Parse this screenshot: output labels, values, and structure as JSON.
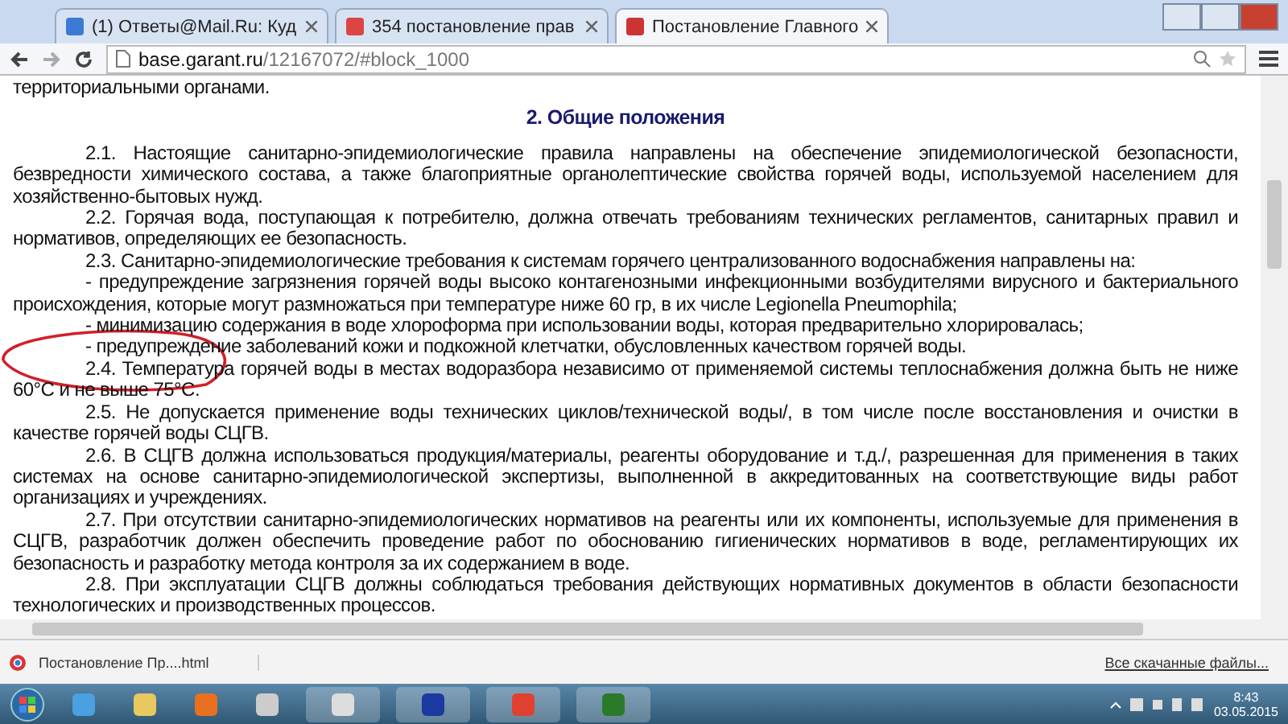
{
  "browser": {
    "tabs": [
      {
        "title": "(1) Ответы@Mail.Ru: Куд",
        "selected": false
      },
      {
        "title": "354 постановление прав",
        "selected": false
      },
      {
        "title": "Постановление Главного",
        "selected": true
      }
    ],
    "address": {
      "host": "base.garant.ru",
      "path": "/12167072/#block_1000"
    }
  },
  "page": {
    "intro_tail": "территориальными органами.",
    "heading": "2. Общие положения",
    "paragraphs": [
      "2.1. Настоящие санитарно-эпидемиологические правила направлены на обеспечение эпидемиологической безопасности, безвредности химического состава, а также благоприятные органолептические свойства горячей воды, используемой населением для хозяйственно-бытовых нужд.",
      "2.2. Горячая вода, поступающая к потребителю, должна отвечать требованиям технических регламентов, санитарных правил и нормативов, определяющих ее безопасность.",
      "2.3. Санитарно-эпидемиологические требования к системам горячего централизованного водоснабжения направлены на:",
      "- предупреждение загрязнения горячей воды высоко контагенозными инфекционными возбудителями вирусного и бактериального происхождения, которые могут размножаться при температуре ниже 60 гр, в их числе Legionella Pneumophila;",
      "- минимизацию содержания в воде хлороформа при использовании воды, которая предварительно хлорировалась;",
      "- предупреждение заболеваний кожи и подкожной клетчатки, обусловленных качеством горячей воды.",
      "2.4. Температура горячей воды в местах водоразбора независимо от применяемой системы теплоснабжения должна быть не ниже 60°C и не выше 75°C.",
      "2.5. Не допускается применение воды технических циклов/технической воды/, в том числе после восстановления и очистки в качестве горячей воды СЦГВ.",
      "2.6. В СЦГВ должна использоваться продукция/материалы, реагенты оборудование и т.д./, разрешенная для применения в таких системах на основе санитарно-эпидемиологической экспертизы, выполненной в аккредитованных на соответствующие виды работ организациях и учреждениях.",
      "2.7. При отсутствии санитарно-эпидемиологических нормативов на реагенты или их компоненты, используемые для применения в СЦГВ, разработчик должен обеспечить проведение работ по обоснованию гигиенических нормативов в воде, регламентирующих их безопасность и разработку метода контроля за их содержанием в воде.",
      "2.8. При эксплуатации СЦГВ должны соблюдаться требования действующих нормативных документов в области безопасности технологических и производственных процессов."
    ]
  },
  "downloads": {
    "file": "Постановление Пр....html",
    "show_all": "Все скачанные файлы..."
  },
  "taskbar": {
    "time": "8:43",
    "date": "03.05.2015"
  }
}
